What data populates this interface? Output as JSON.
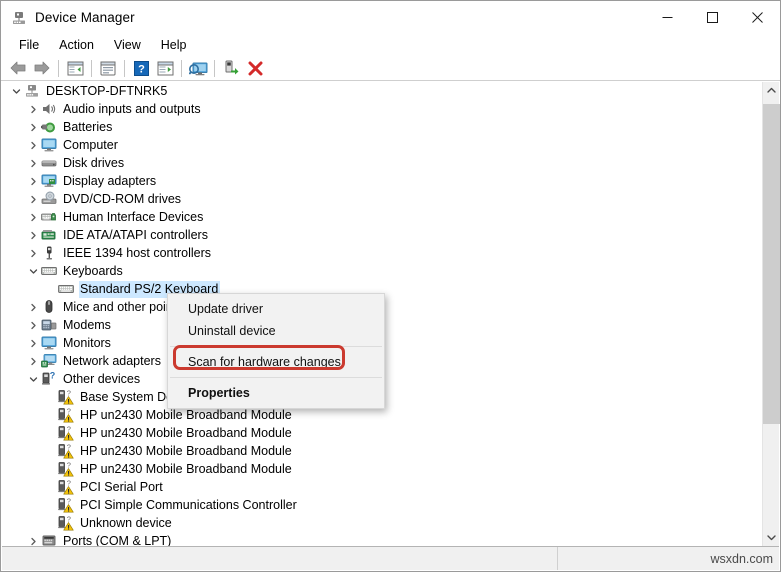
{
  "window": {
    "title": "Device Manager",
    "icon": "device-manager-icon",
    "controls": {
      "minimize": "─",
      "maximize": "□",
      "close": "✕"
    }
  },
  "menubar": {
    "items": [
      {
        "label": "File"
      },
      {
        "label": "Action"
      },
      {
        "label": "View"
      },
      {
        "label": "Help"
      }
    ]
  },
  "toolbar": {
    "buttons": [
      {
        "name": "back-button",
        "icon": "back-arrow-icon",
        "label": "Back"
      },
      {
        "name": "forward-button",
        "icon": "forward-arrow-icon",
        "label": "Forward"
      },
      {
        "name": "show-hide-console-tree-button",
        "icon": "console-tree-icon",
        "label": "Show/Hide Console Tree"
      },
      {
        "name": "properties-button",
        "icon": "properties-window-icon",
        "label": "Properties"
      },
      {
        "name": "help-button",
        "icon": "help-question-icon",
        "label": "Help"
      },
      {
        "name": "update-driver-button",
        "icon": "update-driver-icon",
        "label": "Update driver"
      },
      {
        "name": "scan-for-hardware-changes-button",
        "icon": "scan-monitor-icon",
        "label": "Scan for hardware changes"
      },
      {
        "name": "enable-device-button",
        "icon": "enable-device-icon",
        "label": "Enable device"
      },
      {
        "name": "uninstall-device-button",
        "icon": "red-x-icon",
        "label": "Uninstall device"
      }
    ]
  },
  "tree": {
    "root": {
      "label": "DESKTOP-DFTNRK5",
      "icon": "computer-root-icon",
      "expanded": true,
      "depth": 0
    },
    "items": [
      {
        "label": "Audio inputs and outputs",
        "icon": "speaker-icon",
        "state": "collapsed",
        "depth": 1
      },
      {
        "label": "Batteries",
        "icon": "battery-icon",
        "state": "collapsed",
        "depth": 1
      },
      {
        "label": "Computer",
        "icon": "monitor-icon",
        "state": "collapsed",
        "depth": 1
      },
      {
        "label": "Disk drives",
        "icon": "disk-drive-icon",
        "state": "collapsed",
        "depth": 1
      },
      {
        "label": "Display adapters",
        "icon": "display-adapter-icon",
        "state": "collapsed",
        "depth": 1
      },
      {
        "label": "DVD/CD-ROM drives",
        "icon": "dvd-drive-icon",
        "state": "collapsed",
        "depth": 1
      },
      {
        "label": "Human Interface Devices",
        "icon": "hid-icon",
        "state": "collapsed",
        "depth": 1
      },
      {
        "label": "IDE ATA/ATAPI controllers",
        "icon": "ide-controller-icon",
        "state": "collapsed",
        "depth": 1
      },
      {
        "label": "IEEE 1394 host controllers",
        "icon": "ieee1394-icon",
        "state": "collapsed",
        "depth": 1
      },
      {
        "label": "Keyboards",
        "icon": "keyboard-icon",
        "state": "expanded",
        "depth": 1
      },
      {
        "label": "Standard PS/2 Keyboard",
        "icon": "keyboard-icon",
        "state": "leaf",
        "depth": 2,
        "selected": true
      },
      {
        "label": "Mice and other pointing devices",
        "icon": "mouse-icon",
        "state": "collapsed",
        "depth": 1
      },
      {
        "label": "Modems",
        "icon": "modem-icon",
        "state": "collapsed",
        "depth": 1
      },
      {
        "label": "Monitors",
        "icon": "monitor-icon",
        "state": "collapsed",
        "depth": 1
      },
      {
        "label": "Network adapters",
        "icon": "network-adapter-icon",
        "state": "collapsed",
        "depth": 1
      },
      {
        "label": "Other devices",
        "icon": "unknown-device-icon",
        "state": "expanded",
        "depth": 1
      },
      {
        "label": "Base System Device",
        "icon": "warning-device-icon",
        "state": "leaf",
        "depth": 2
      },
      {
        "label": "HP un2430 Mobile Broadband Module",
        "icon": "warning-device-icon",
        "state": "leaf",
        "depth": 2
      },
      {
        "label": "HP un2430 Mobile Broadband Module",
        "icon": "warning-device-icon",
        "state": "leaf",
        "depth": 2
      },
      {
        "label": "HP un2430 Mobile Broadband Module",
        "icon": "warning-device-icon",
        "state": "leaf",
        "depth": 2
      },
      {
        "label": "HP un2430 Mobile Broadband Module",
        "icon": "warning-device-icon",
        "state": "leaf",
        "depth": 2
      },
      {
        "label": "PCI Serial Port",
        "icon": "warning-device-icon",
        "state": "leaf",
        "depth": 2
      },
      {
        "label": "PCI Simple Communications Controller",
        "icon": "warning-device-icon",
        "state": "leaf",
        "depth": 2
      },
      {
        "label": "Unknown device",
        "icon": "warning-device-icon",
        "state": "leaf",
        "depth": 2
      },
      {
        "label": "Ports (COM & LPT)",
        "icon": "port-icon",
        "state": "collapsed",
        "depth": 1
      }
    ]
  },
  "context_menu": {
    "items": [
      {
        "label": "Update driver",
        "bold": false,
        "separator_after": false
      },
      {
        "label": "Uninstall device",
        "bold": false,
        "separator_after": true
      },
      {
        "label": "Scan for hardware changes",
        "bold": false,
        "separator_after": true,
        "highlighted": true
      },
      {
        "label": "Properties",
        "bold": true,
        "separator_after": false
      }
    ]
  },
  "annotation": {
    "highlight_color": "#cb3a2f",
    "target_label": "Scan for hardware changes"
  },
  "statusbar": {
    "left_text": "",
    "right_text": "wsxdn.com"
  },
  "colors": {
    "selection": "#cde8ff",
    "accent_red": "#cb3a2f",
    "chrome": "#f0f0f0"
  }
}
